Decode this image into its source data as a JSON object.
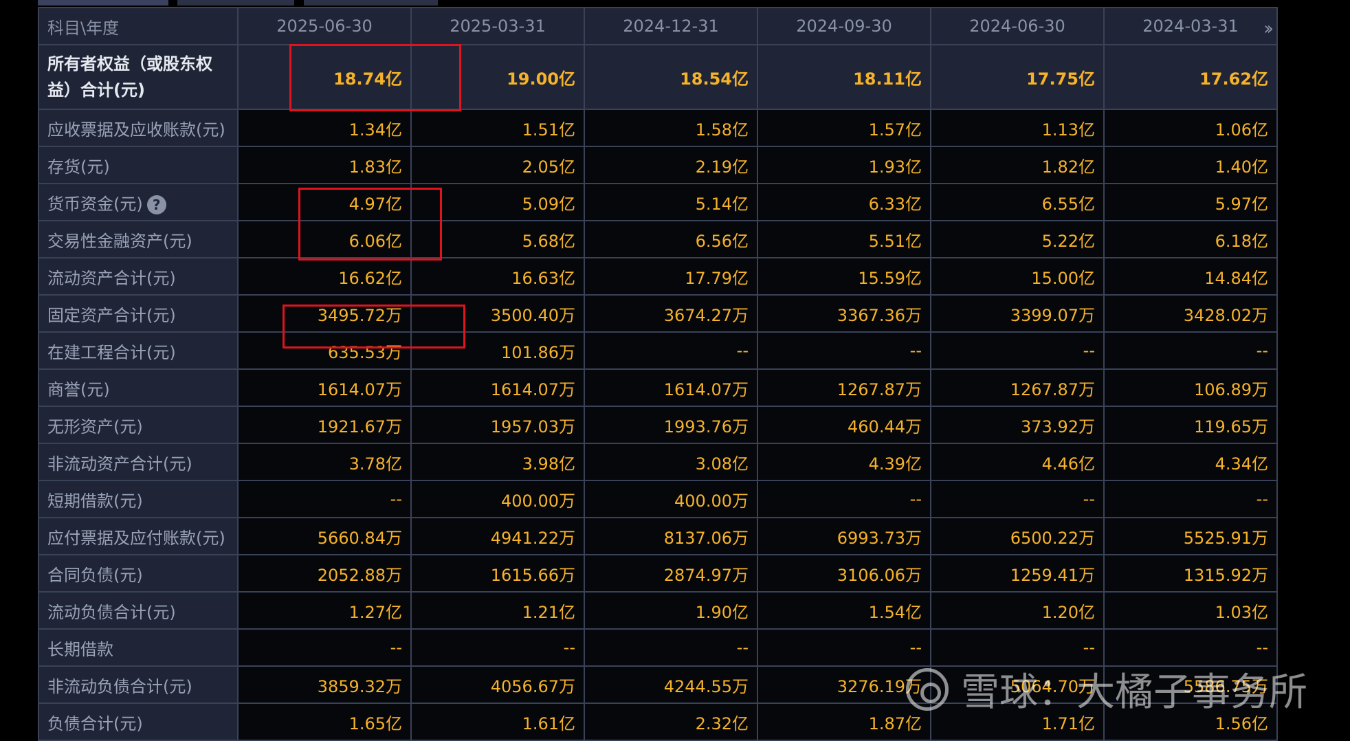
{
  "table": {
    "header_label": "科目\\年度",
    "columns": [
      "2025-06-30",
      "2025-03-31",
      "2024-12-31",
      "2024-09-30",
      "2024-06-30",
      "2024-03-31"
    ],
    "more_icon": "double-chevron-right-icon",
    "rows": [
      {
        "label": "所有者权益（或股东权益）合计(元)",
        "values": [
          "18.74亿",
          "19.00亿",
          "18.54亿",
          "18.11亿",
          "17.75亿",
          "17.62亿"
        ]
      },
      {
        "label": "应收票据及应收账款(元)",
        "values": [
          "1.34亿",
          "1.51亿",
          "1.58亿",
          "1.57亿",
          "1.13亿",
          "1.06亿"
        ]
      },
      {
        "label": "存货(元)",
        "values": [
          "1.83亿",
          "2.05亿",
          "2.19亿",
          "1.93亿",
          "1.82亿",
          "1.40亿"
        ]
      },
      {
        "label": "货币资金(元)",
        "values": [
          "4.97亿",
          "5.09亿",
          "5.14亿",
          "6.33亿",
          "6.55亿",
          "5.97亿"
        ]
      },
      {
        "label": "交易性金融资产(元)",
        "values": [
          "6.06亿",
          "5.68亿",
          "6.56亿",
          "5.51亿",
          "5.22亿",
          "6.18亿"
        ]
      },
      {
        "label": "流动资产合计(元)",
        "values": [
          "16.62亿",
          "16.63亿",
          "17.79亿",
          "15.59亿",
          "15.00亿",
          "14.84亿"
        ]
      },
      {
        "label": "固定资产合计(元)",
        "values": [
          "3495.72万",
          "3500.40万",
          "3674.27万",
          "3367.36万",
          "3399.07万",
          "3428.02万"
        ]
      },
      {
        "label": "在建工程合计(元)",
        "values": [
          "635.53万",
          "101.86万",
          "--",
          "--",
          "--",
          "--"
        ]
      },
      {
        "label": "商誉(元)",
        "values": [
          "1614.07万",
          "1614.07万",
          "1614.07万",
          "1267.87万",
          "1267.87万",
          "106.89万"
        ]
      },
      {
        "label": "无形资产(元)",
        "values": [
          "1921.67万",
          "1957.03万",
          "1993.76万",
          "460.44万",
          "373.92万",
          "119.65万"
        ]
      },
      {
        "label": "非流动资产合计(元)",
        "values": [
          "3.78亿",
          "3.98亿",
          "3.08亿",
          "4.39亿",
          "4.46亿",
          "4.34亿"
        ]
      },
      {
        "label": "短期借款(元)",
        "values": [
          "--",
          "400.00万",
          "400.00万",
          "--",
          "--",
          "--"
        ]
      },
      {
        "label": "应付票据及应付账款(元)",
        "values": [
          "5660.84万",
          "4941.22万",
          "8137.06万",
          "6993.73万",
          "6500.22万",
          "5525.91万"
        ]
      },
      {
        "label": "合同负债(元)",
        "values": [
          "2052.88万",
          "1615.66万",
          "2874.97万",
          "3106.06万",
          "1259.41万",
          "1315.92万"
        ]
      },
      {
        "label": "流动负债合计(元)",
        "values": [
          "1.27亿",
          "1.21亿",
          "1.90亿",
          "1.54亿",
          "1.20亿",
          "1.03亿"
        ]
      },
      {
        "label": "长期借款",
        "values": [
          "--",
          "--",
          "--",
          "--",
          "--",
          "--"
        ]
      },
      {
        "label": "非流动负债合计(元)",
        "values": [
          "3859.32万",
          "4056.67万",
          "4244.55万",
          "3276.19万",
          "5064.70万",
          "5586.75万"
        ]
      },
      {
        "label": "负债合计(元)",
        "values": [
          "1.65亿",
          "1.61亿",
          "2.32亿",
          "1.87亿",
          "1.71亿",
          "1.56亿"
        ]
      }
    ]
  },
  "help_icon": "question-mark-icon",
  "help_symbol": "?",
  "watermark": {
    "logo_icon": "xueqiu-logo-icon",
    "text": "雪球：大橘子事务所"
  },
  "colors": {
    "value": "#f5b22b",
    "label": "#9aa2b8",
    "highlight_box": "#e0141e"
  }
}
